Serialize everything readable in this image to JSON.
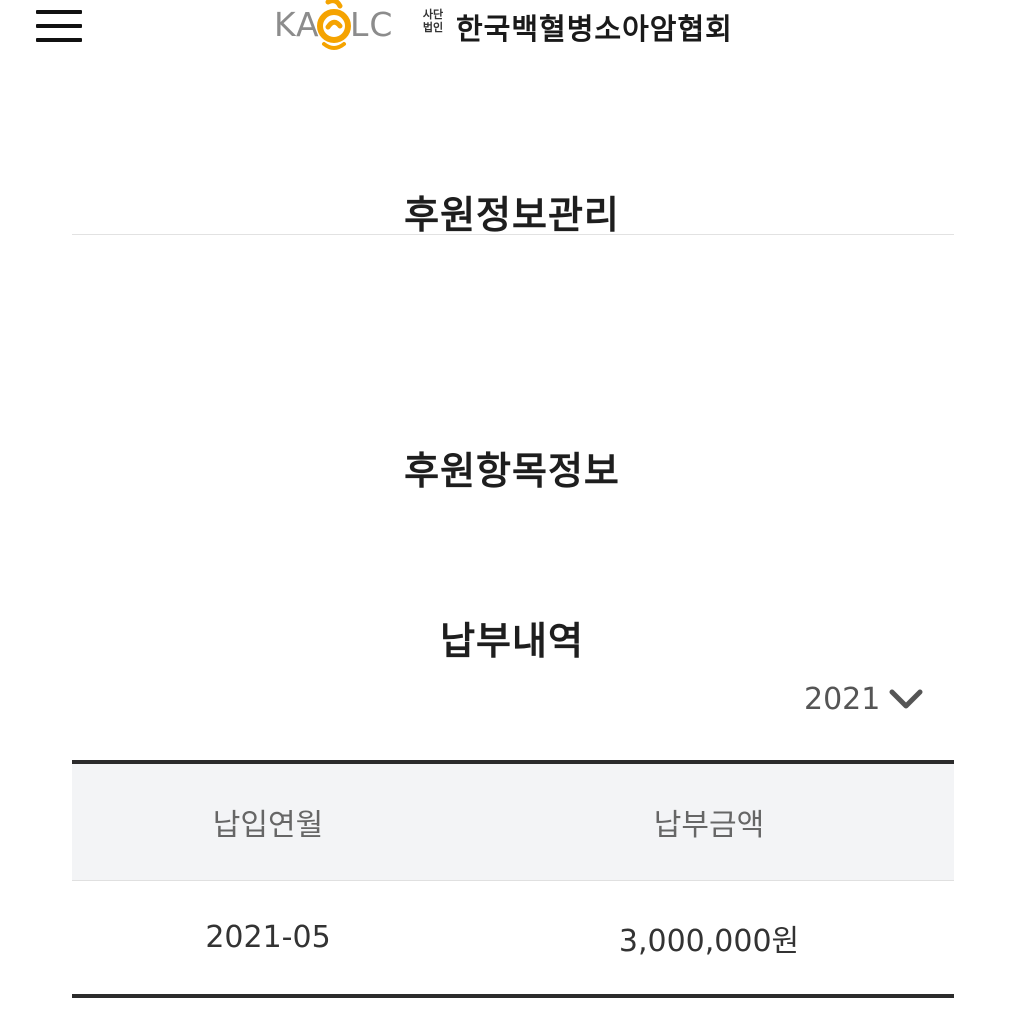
{
  "header": {
    "logo_letters_left": "KA",
    "logo_letters_right": "LC",
    "logo_small_top": "사단",
    "logo_small_bottom": "법인",
    "org_name": "한국백혈병소아암협회",
    "menu_icon": "hamburger-menu-icon"
  },
  "sections": {
    "support_info_manage": "후원정보관리",
    "support_item_info": "후원항목정보",
    "payment_history": "납부내역"
  },
  "year_select": {
    "selected": "2021",
    "icon": "chevron-down-icon"
  },
  "payment_table": {
    "columns": [
      "납입연월",
      "납부금액"
    ],
    "rows": [
      [
        "2021-05",
        "3,000,000원"
      ]
    ]
  },
  "colors": {
    "logo_orange": "#f5a300",
    "logo_gray": "#8c8c8c",
    "table_header_bg": "#f3f4f6",
    "table_border": "#2b2b2b"
  }
}
